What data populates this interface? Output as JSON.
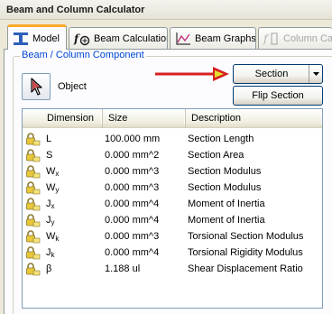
{
  "window": {
    "title": "Beam and Column Calculator"
  },
  "tabs": [
    {
      "label": "Model",
      "icon": "beam-section-icon",
      "active": true
    },
    {
      "label": "Beam Calculation",
      "icon": "function-icon",
      "active": false
    },
    {
      "label": "Beam Graphs",
      "icon": "graph-icon",
      "active": false
    },
    {
      "label": "Column Calcu",
      "icon": "column-calc-icon",
      "active": false,
      "disabled": true
    }
  ],
  "group": {
    "label": "Beam / Column Component"
  },
  "object": {
    "label": "Object",
    "icon": "select-cursor-icon"
  },
  "buttons": {
    "section": "Section",
    "flip_section": "Flip Section"
  },
  "table": {
    "columns": [
      "Dimension",
      "Size",
      "Description"
    ],
    "rows": [
      {
        "dim": "L",
        "sub": "",
        "size": "100.000 mm",
        "desc": "Section Length"
      },
      {
        "dim": "S",
        "sub": "",
        "size": "0.000 mm^2",
        "desc": "Section Area"
      },
      {
        "dim": "W",
        "sub": "x",
        "size": "0.000 mm^3",
        "desc": "Section Modulus"
      },
      {
        "dim": "W",
        "sub": "y",
        "size": "0.000 mm^3",
        "desc": "Section Modulus"
      },
      {
        "dim": "J",
        "sub": "x",
        "size": "0.000 mm^4",
        "desc": "Moment of Inertia"
      },
      {
        "dim": "J",
        "sub": "y",
        "size": "0.000 mm^4",
        "desc": "Moment of Inertia"
      },
      {
        "dim": "W",
        "sub": "k",
        "size": "0.000 mm^3",
        "desc": "Torsional Section Modulus"
      },
      {
        "dim": "J",
        "sub": "k",
        "size": "0.000 mm^4",
        "desc": "Torsional Rigidity Modulus"
      },
      {
        "dim": "β",
        "sub": "",
        "size": "1.188 ul",
        "desc": "Shear Displacement Ratio"
      }
    ]
  },
  "colors": {
    "accent_tab": "#f9a92c",
    "group_label": "#0046d5",
    "arrow": "#d62020"
  }
}
